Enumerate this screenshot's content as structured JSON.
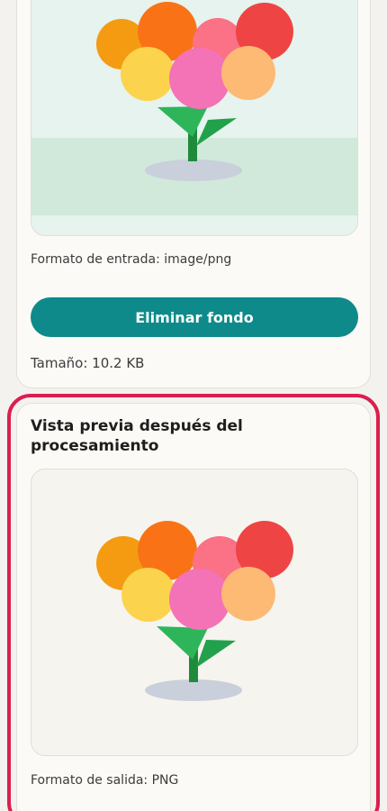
{
  "input_card": {
    "format_label": "Formato de entrada: image/png",
    "remove_bg_button": "Eliminar fondo",
    "size_label": "Tamaño: 10.2 KB"
  },
  "output_card": {
    "title": "Vista previa después del procesamiento",
    "format_label": "Formato de salida: PNG"
  },
  "colors": {
    "accent_button": "#0f8a8a",
    "highlight_border": "#dc1e4f",
    "input_bg": "#e6f3ee",
    "input_ground": "#d1e9da",
    "output_bg": "#f6f4ef"
  },
  "images": {
    "input_preview": "flower-bouquet-illustration",
    "output_preview": "flower-bouquet-illustration-transparent"
  }
}
